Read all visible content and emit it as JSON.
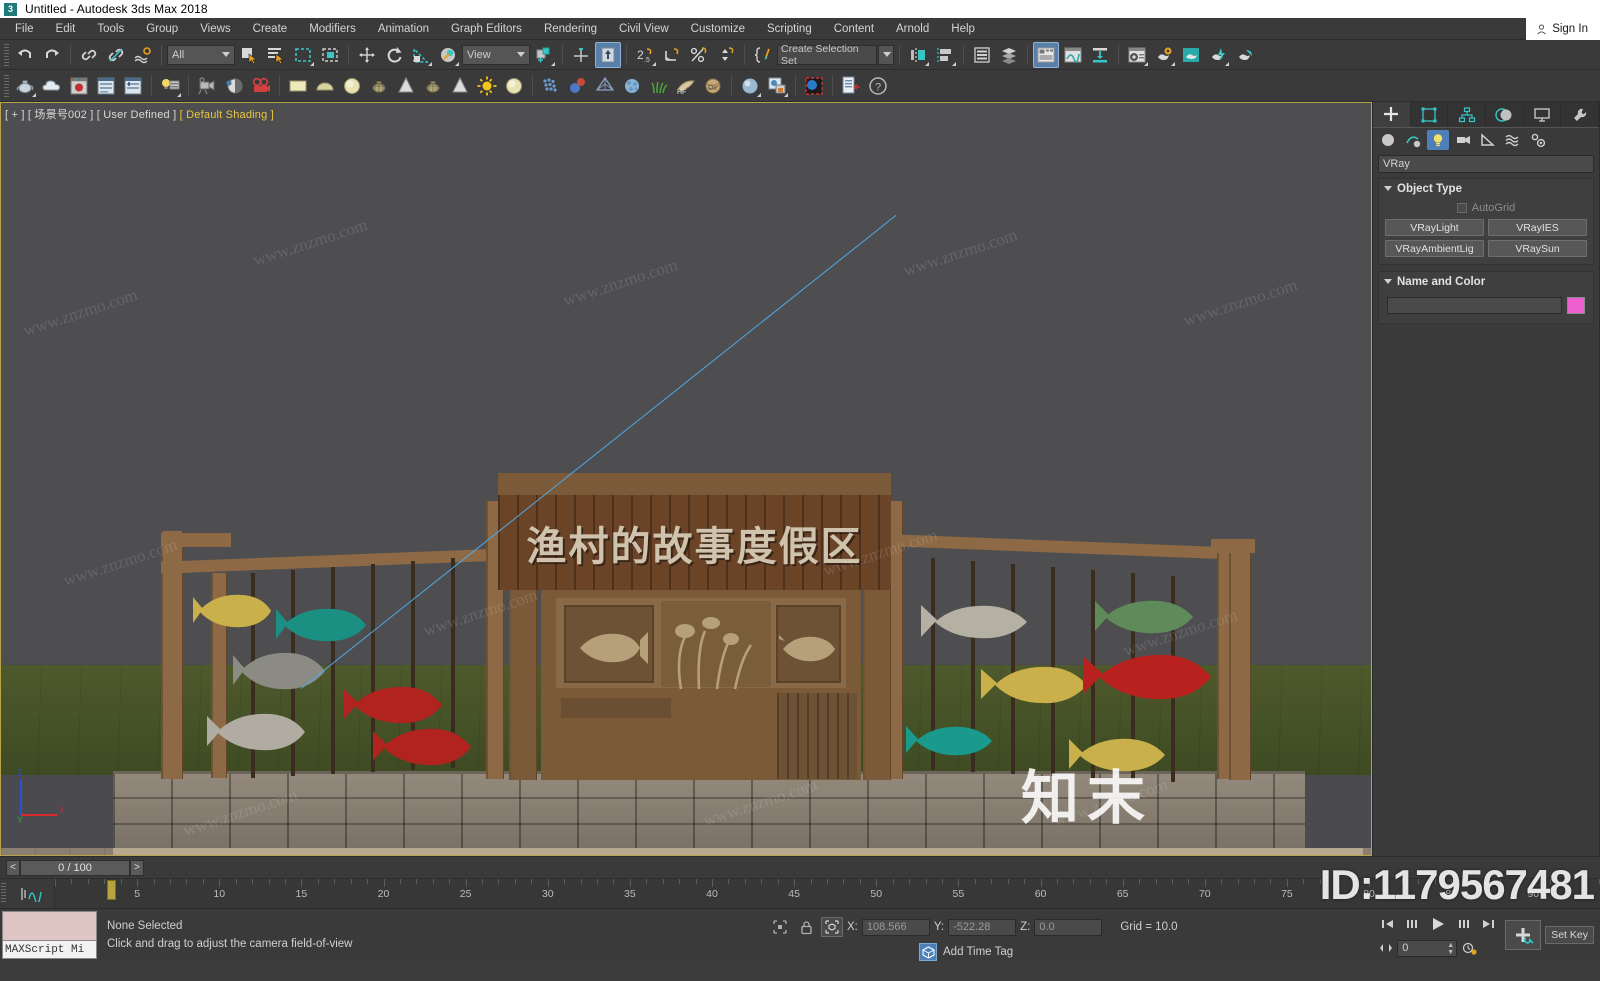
{
  "titlebar": {
    "logo": "3",
    "title": "Untitled - Autodesk 3ds Max 2018"
  },
  "menubar": {
    "items": [
      "File",
      "Edit",
      "Tools",
      "Group",
      "Views",
      "Create",
      "Modifiers",
      "Animation",
      "Graph Editors",
      "Rendering",
      "Civil View",
      "Customize",
      "Scripting",
      "Content",
      "Arnold",
      "Help"
    ],
    "signin": "Sign In"
  },
  "toolbar1": {
    "selection_filter": "All",
    "reference_coord": "View",
    "named_selection_set": "Create Selection Set",
    "buttons": [
      "undo-icon",
      "redo-icon",
      "select-link-icon",
      "unlink-icon",
      "bind-space-warp-icon",
      "select-object-icon",
      "select-by-name-icon",
      "rectangular-selection-region-icon",
      "window-crossing-icon",
      "select-and-move-icon",
      "select-and-rotate-icon",
      "select-and-scale-icon",
      "select-and-place-icon",
      "use-pivot-center-icon",
      "snaps-toggle-icon",
      "angle-snap-toggle-icon",
      "percent-snap-toggle-icon",
      "spinner-snap-toggle-icon",
      "edit-named-selection-sets-icon",
      "mirror-icon",
      "align-icon",
      "layer-explorer-icon",
      "scene-explorer-icon",
      "toggle-ribbon-icon",
      "curve-editor-icon",
      "schematic-view-icon",
      "material-editor-icon",
      "render-setup-icon",
      "render-frame-window-icon",
      "render-production-icon",
      "render-iterative-icon",
      "active-shade-icon"
    ]
  },
  "toolbar2": {
    "buttons": [
      "teapot-icon",
      "cloud-icon",
      "render-preview-icon",
      "list-panel-icon",
      "settings-panel-icon",
      "light-lister-icon",
      "camera-icon",
      "shading-icon",
      "video-post-icon",
      "plane-icon",
      "dome-icon",
      "sphere-icon",
      "teapot-wire-icon",
      "cone-icon",
      "teapot2-icon",
      "cone2-icon",
      "sun-icon",
      "sphere2-icon",
      "particles-icon",
      "compound-icon",
      "spacewarp-icon",
      "noise-icon",
      "grass-icon",
      "hair-fur-icon",
      "ornatrix-icon",
      "sphere3-icon",
      "map-browser-icon",
      "render-region-icon",
      "scene-converter-icon",
      "help-icon"
    ]
  },
  "viewport": {
    "label_prefix": "[ + ]",
    "label_scene": "[ 场景号002 ]",
    "label_view": "[ User Defined ]",
    "label_shading": "[ Default Shading ]",
    "sign_text": "渔村的故事度假区",
    "axis": {
      "x": "X",
      "y": "Y",
      "z": "Z"
    }
  },
  "command_panel": {
    "tabs": [
      "create-tab",
      "modify-tab",
      "hierarchy-tab",
      "motion-tab",
      "display-tab",
      "utilities-tab"
    ],
    "subtabs": [
      "geometry-icon",
      "shapes-icon",
      "lights-icon",
      "cameras-icon",
      "helpers-icon",
      "spacewarps-icon",
      "systems-icon"
    ],
    "category": "VRay",
    "object_type": {
      "title": "Object Type",
      "autogrid": "AutoGrid",
      "buttons": [
        "VRayLight",
        "VRayIES",
        "VRayAmbientLig",
        "VRaySun"
      ]
    },
    "name_and_color": {
      "title": "Name and Color",
      "name_value": "",
      "color": "#ee5fd0"
    }
  },
  "timeslider": {
    "prev": "<",
    "current": "0 / 100",
    "next": ">"
  },
  "trackbar": {
    "ticks": [
      "5",
      "10",
      "15",
      "20",
      "25",
      "30",
      "35",
      "40",
      "45",
      "50",
      "55",
      "60",
      "65",
      "70",
      "75",
      "80",
      "85",
      "90"
    ],
    "slider_pos_label": "0"
  },
  "statusbar": {
    "maxscript_listener": "MAXScript Mi",
    "selection_status": "None Selected",
    "prompt": "Click and drag to adjust the camera field-of-view",
    "coords": {
      "x_label": "X:",
      "x": "108.566",
      "y_label": "Y:",
      "y": "-522.28",
      "z_label": "Z:",
      "z": "0.0"
    },
    "grid": "Grid = 10.0",
    "add_time_tag": "Add Time Tag",
    "key_spinner": "0",
    "set_key": "Set Key",
    "icons": [
      "selection-lock-icon",
      "absolute-relative-icon",
      "isolate-selection-icon",
      "key-filters-icon"
    ]
  },
  "watermarks": {
    "small": "www.znzmo.com",
    "brand": "知末",
    "id": "ID:1179567481"
  }
}
